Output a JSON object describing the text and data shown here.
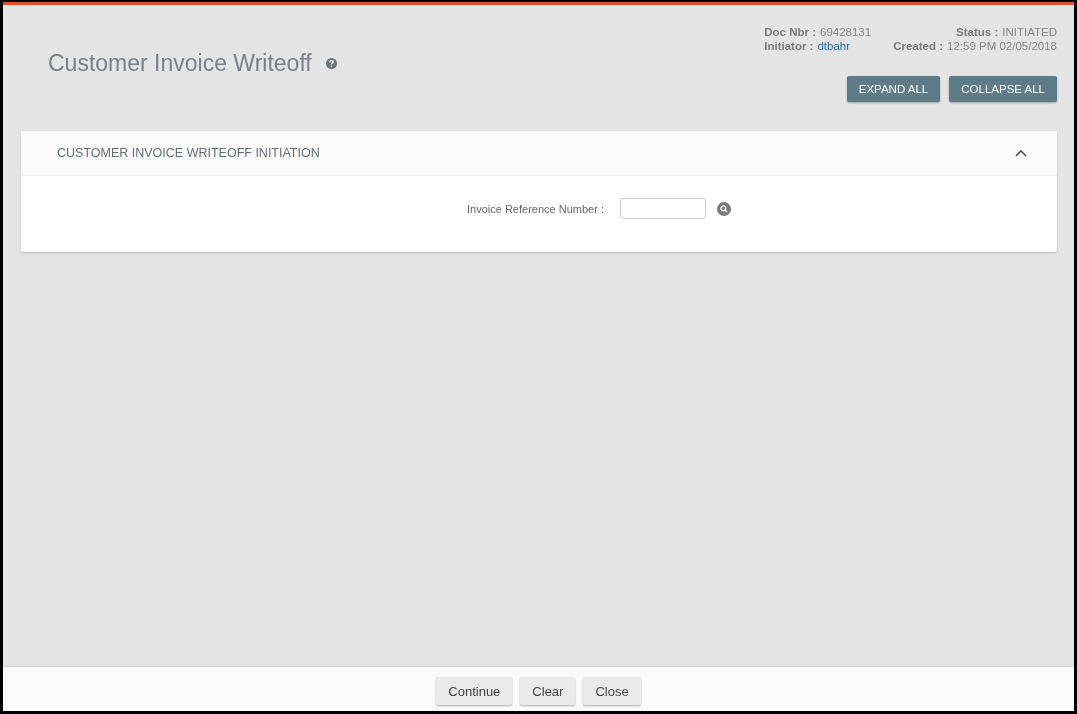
{
  "page": {
    "title": "Customer Invoice Writeoff"
  },
  "doc_info": [
    {
      "label": "Doc Nbr :",
      "value": "69428131",
      "kind": "text"
    },
    {
      "label": "Status :",
      "value": "INITIATED",
      "kind": "text"
    },
    {
      "label": "Initiator :",
      "value": "dtbahr",
      "kind": "link"
    },
    {
      "label": "Created :",
      "value": "12:59 PM 02/05/2018",
      "kind": "text"
    }
  ],
  "toolbar_buttons": [
    "EXPAND ALL",
    "COLLAPSE ALL"
  ],
  "section": {
    "title": "CUSTOMER INVOICE WRITEOFF INITIATION",
    "expanded": true,
    "fields": [
      {
        "label": "Invoice Reference Number :"
      }
    ]
  },
  "footer_buttons": [
    "Continue",
    "Clear",
    "Close"
  ]
}
